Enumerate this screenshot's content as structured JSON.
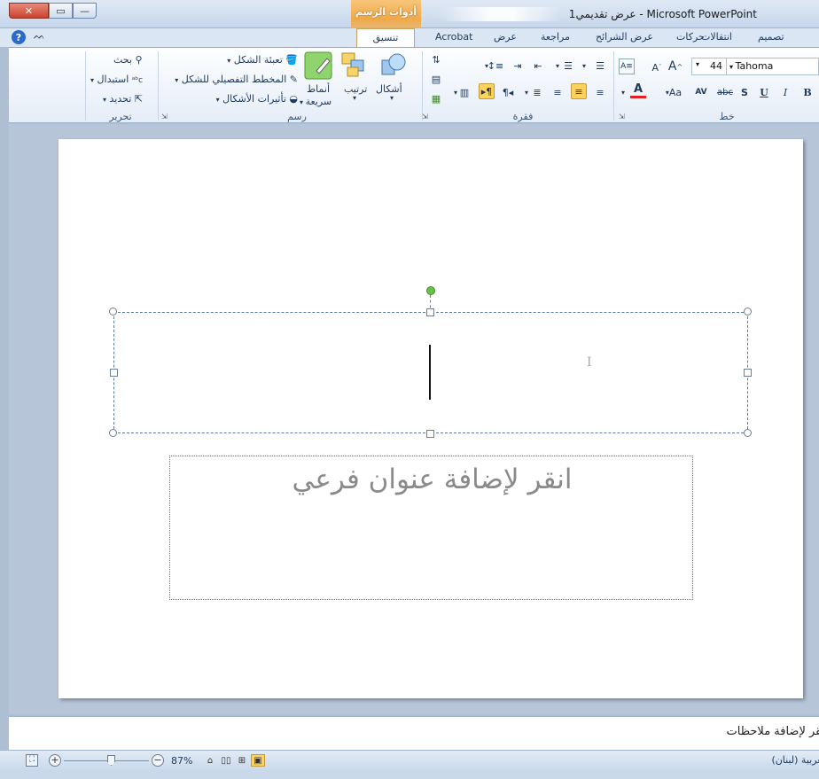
{
  "window": {
    "title": "عرض تقديمي1 - Microsoft PowerPoint",
    "contextual_tab_group": "أدوات الرسم",
    "controls": {
      "close": "✕",
      "maximize": "▭",
      "minimize": "—"
    }
  },
  "tabs": [
    {
      "label": "تصميم"
    },
    {
      "label": "انتقالات"
    },
    {
      "label": "حركات"
    },
    {
      "label": "عرض الشرائح"
    },
    {
      "label": "مراجعة"
    },
    {
      "label": "عرض"
    },
    {
      "label": "Acrobat"
    },
    {
      "label": "تنسيق",
      "active": true
    }
  ],
  "ribbon": {
    "font": {
      "group_label": "خط",
      "font_name": "Tahoma",
      "font_size": "44",
      "grow": "A",
      "shrink": "A",
      "bold": "B",
      "italic": "I",
      "underline": "U",
      "shadow": "S",
      "strike": "abc",
      "spacing": "AV",
      "case": "Aa",
      "color": "A"
    },
    "paragraph": {
      "group_label": "فقرة"
    },
    "drawing": {
      "group_label": "رسم",
      "shapes": "أشكال",
      "arrange": "ترتيب",
      "quick_styles_1": "أنماط",
      "quick_styles_2": "سريعة",
      "shape_fill": "تعبئة الشكل",
      "shape_outline": "المخطط التفصيلي للشكل",
      "shape_effects": "تأثيرات الأشكال"
    },
    "editing": {
      "group_label": "تحرير",
      "find": "بحث",
      "replace": "استبدال",
      "select": "تحديد"
    }
  },
  "slide": {
    "title_placeholder": "",
    "subtitle_placeholder": "انقر لإضافة عنوان فرعي"
  },
  "notes": {
    "placeholder": "انقر لإضافة ملاحظات"
  },
  "statusbar": {
    "language": "العربية (لبنان)",
    "zoom": "87%",
    "zoom_level": 0.87
  },
  "colors": {
    "accent_orange": "#f0a948",
    "ribbon_blue": "#1e395b",
    "active_button": "#ffd25e",
    "rotation_handle": "#6cc04a"
  }
}
